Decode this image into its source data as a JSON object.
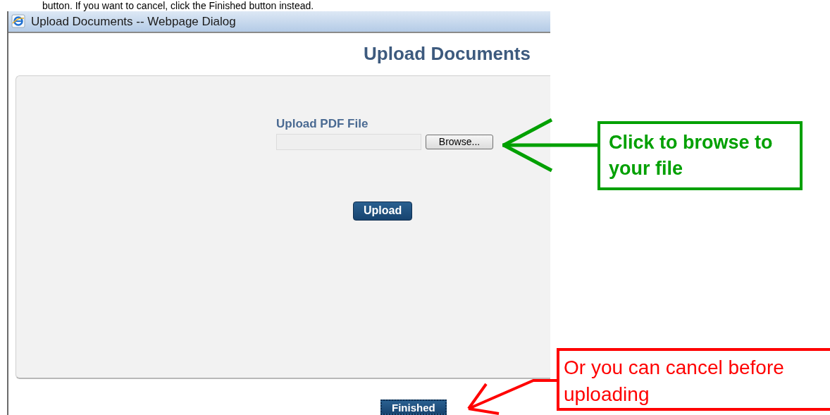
{
  "instruction_text": "button. If you want to cancel, click the Finished button instead.",
  "window": {
    "title": "Upload Documents -- Webpage Dialog"
  },
  "page_heading": "Upload Documents",
  "form": {
    "file_label": "Upload PDF File",
    "browse_button": "Browse...",
    "upload_button": "Upload"
  },
  "finished_button": "Finished",
  "callouts": [
    {
      "text": "Click to browse to your file",
      "color": "#00a000"
    },
    {
      "text": "Or you can cancel before uploading",
      "color": "#ff0000"
    }
  ]
}
